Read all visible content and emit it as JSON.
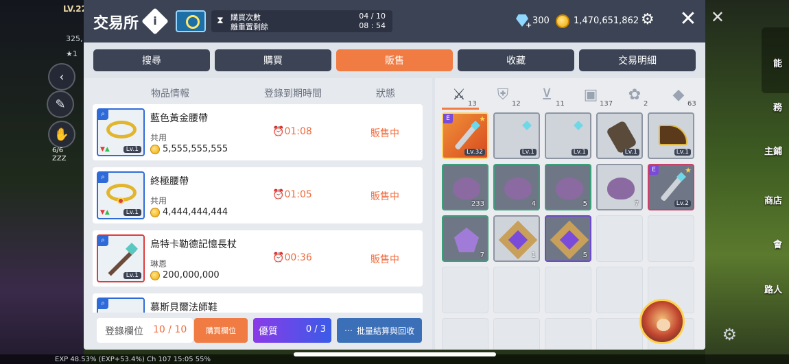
{
  "hud": {
    "level": "LV.22",
    "power": "325,",
    "star_line": "★1",
    "hp": "6/6",
    "zzz": "ZZZ",
    "right_labels": [
      "能",
      "務",
      "主鋪",
      "商店",
      "會",
      "路人"
    ],
    "bottom_bar": "EXP 48.53% (EXP+53.4%) Ch 107 15:05 55%"
  },
  "header": {
    "title": "交易所",
    "info_icon": "info-diamond-icon",
    "purchase_label": "購買次數",
    "purchase_value": "04 / 10",
    "reset_label": "離重置剩餘",
    "reset_value": "08 : 54",
    "diamonds": "300",
    "meso": "1,470,651,862",
    "close_label": "✕"
  },
  "tabs": [
    {
      "label": "搜尋",
      "active": false
    },
    {
      "label": "購買",
      "active": false
    },
    {
      "label": "販售",
      "active": true
    },
    {
      "label": "收藏",
      "active": false
    },
    {
      "label": "交易明細",
      "active": false
    }
  ],
  "list_headers": {
    "info": "物品情報",
    "expiry": "登錄到期時間",
    "status": "狀態"
  },
  "listings": [
    {
      "name": "藍色黃金腰帶",
      "class": "共用",
      "price": "5,555,555,555",
      "timer": "01:08",
      "status": "販售中",
      "level": "Lv.1",
      "frame": "blue"
    },
    {
      "name": "終極腰帶",
      "class": "共用",
      "price": "4,444,444,444",
      "timer": "01:05",
      "status": "販售中",
      "level": "Lv.1",
      "frame": "blue"
    },
    {
      "name": "烏特卡勒德記憶長杖",
      "class": "琳恩",
      "price": "200,000,000",
      "timer": "00:36",
      "status": "販售中",
      "level": "Lv.1",
      "frame": "red"
    },
    {
      "name": "慕斯貝爾法師鞋",
      "class": "",
      "price": "",
      "timer": "",
      "status": "",
      "level": "",
      "frame": "blue"
    }
  ],
  "footer": {
    "slot_label": "登錄欄位",
    "slot_value": "10 / 10",
    "buy_slot": "購買欄位",
    "premium_label": "優質",
    "premium_value": "0 / 3",
    "batch_label": "批量結算與回收"
  },
  "categories": [
    {
      "icon": "sword-icon",
      "glyph": "⚔",
      "count": "13",
      "active": true
    },
    {
      "icon": "shield-icon",
      "glyph": "⛨",
      "count": "12",
      "active": false
    },
    {
      "icon": "necklace-icon",
      "glyph": "⊻",
      "count": "11",
      "active": false
    },
    {
      "icon": "briefcase-icon",
      "glyph": "▣",
      "count": "137",
      "active": false
    },
    {
      "icon": "pet-icon",
      "glyph": "✿",
      "count": "2",
      "active": false
    },
    {
      "icon": "diamond-icon",
      "glyph": "◆",
      "count": "63",
      "active": false
    }
  ],
  "inventory": [
    {
      "kind": "weapon",
      "style": "orange",
      "level": "Lv.32",
      "badge": "E",
      "star": "★"
    },
    {
      "kind": "weapon",
      "style": "filled",
      "level": "Lv.1"
    },
    {
      "kind": "weapon",
      "style": "filled",
      "level": "Lv.1"
    },
    {
      "kind": "cannon",
      "style": "filled",
      "level": "Lv.1"
    },
    {
      "kind": "fan",
      "style": "filled",
      "level": "Lv.1"
    },
    {
      "kind": "bag",
      "style": "green",
      "qty": "233"
    },
    {
      "kind": "bag",
      "style": "green",
      "qty": "4"
    },
    {
      "kind": "bag",
      "style": "green",
      "qty": "5"
    },
    {
      "kind": "bag",
      "style": "filled",
      "qty": "7"
    },
    {
      "kind": "weapon",
      "style": "red-b",
      "level": "Lv.2",
      "badge": "E",
      "star": "★"
    },
    {
      "kind": "crystal",
      "style": "green",
      "qty": "7"
    },
    {
      "kind": "frame",
      "style": "filled",
      "qty": "1"
    },
    {
      "kind": "frame",
      "style": "purple",
      "qty": "5"
    }
  ],
  "grid_total_slots": 25
}
